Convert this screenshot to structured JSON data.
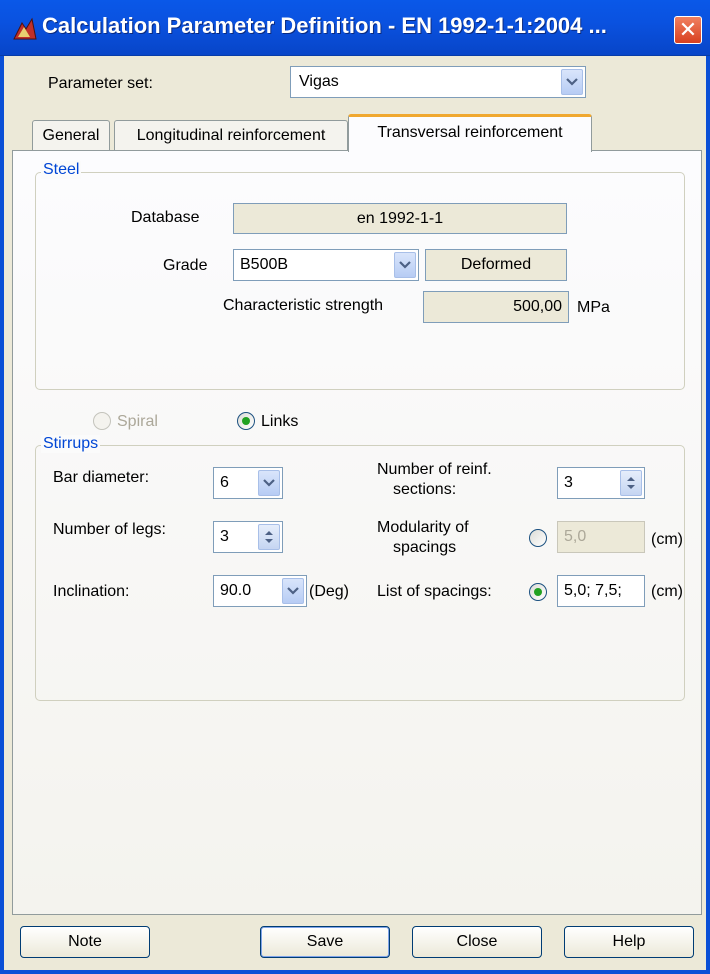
{
  "window": {
    "title": "Calculation Parameter Definition - EN 1992-1-1:2004 ...",
    "close_glyph": "✕"
  },
  "parameter_set": {
    "label": "Parameter set:",
    "value": "Vigas"
  },
  "tabs": [
    {
      "label": "General"
    },
    {
      "label": "Longitudinal reinforcement"
    },
    {
      "label": "Transversal reinforcement"
    }
  ],
  "steel": {
    "title": "Steel",
    "database_label": "Database",
    "database_value": "en 1992-1-1",
    "grade_label": "Grade",
    "grade_value": "B500B",
    "grade_type": "Deformed",
    "strength_label": "Characteristic strength",
    "strength_value": "500,00",
    "strength_unit": "MPa"
  },
  "shape": {
    "spiral_label": "Spiral",
    "links_label": "Links",
    "selected": "Links"
  },
  "stirrups": {
    "title": "Stirrups",
    "bar_diameter_label": "Bar diameter:",
    "bar_diameter_value": "6",
    "legs_label": "Number of legs:",
    "legs_value": "3",
    "inclination_label": "Inclination:",
    "inclination_value": "90.0",
    "inclination_unit": "(Deg)",
    "sections_label_1": "Number of reinf.",
    "sections_label_2": "sections:",
    "sections_value": "3",
    "modularity_label_1": "Modularity of",
    "modularity_label_2": "spacings",
    "modularity_value": "5,0",
    "modularity_unit": "(cm)",
    "spacings_label": "List of spacings:",
    "spacings_value": "5,0; 7,5;",
    "spacings_unit": "(cm)",
    "spacing_mode_selected": "List of spacings"
  },
  "buttons": {
    "note": "Note",
    "save": "Save",
    "close": "Close",
    "help": "Help"
  },
  "colors": {
    "titlebar": "#0a52e0",
    "group_title": "#0046d5",
    "active_tab_accent": "#f0a830",
    "radio_dot": "#21a121"
  }
}
